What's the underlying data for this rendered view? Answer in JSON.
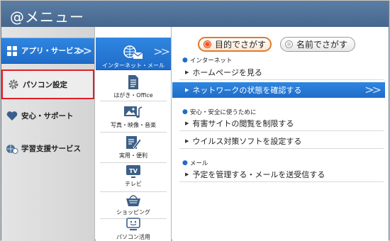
{
  "window": {
    "title": "@メニュー"
  },
  "left_tabs": [
    {
      "label": "アプリ・サービス",
      "icon": "grid-icon"
    },
    {
      "label": "パソコン設定",
      "icon": "gear-icon"
    },
    {
      "label": "安心・サポート",
      "icon": "heart-icon"
    },
    {
      "label": "学習支援サービス",
      "icon": "learning-globe-icon"
    }
  ],
  "categories": [
    {
      "label": "インターネット・メール",
      "icon": "globe-mail-icon"
    },
    {
      "label": "はがき・Office",
      "icon": "document-icon"
    },
    {
      "label": "写真・映像・音楽",
      "icon": "photo-music-icon"
    },
    {
      "label": "実用・便利",
      "icon": "pen-icon"
    },
    {
      "label": "テレビ",
      "icon": "tv-icon"
    },
    {
      "label": "ショッピング",
      "icon": "basket-icon"
    },
    {
      "label": "パソコン活用",
      "icon": "pc-face-icon"
    }
  ],
  "search_mode": {
    "purpose": "目的でさがす",
    "name": "名前でさがす",
    "selected": "purpose"
  },
  "sections": [
    {
      "heading": "インターネット",
      "items": [
        "ホームページを見る",
        "ネットワークの状態を確認する"
      ]
    },
    {
      "heading": "安心・安全に使うために",
      "items": [
        "有害サイトの閲覧を制限する",
        "ウイルス対策ソフトを設定する"
      ]
    },
    {
      "heading": "メール",
      "items": [
        "予定を管理する・メールを送受信する"
      ]
    }
  ],
  "colors": {
    "titlebar": "#4f7198",
    "accent_blue": "#1f6cc8",
    "highlight_red": "#e0202a",
    "radio_orange": "#e07a2a"
  }
}
